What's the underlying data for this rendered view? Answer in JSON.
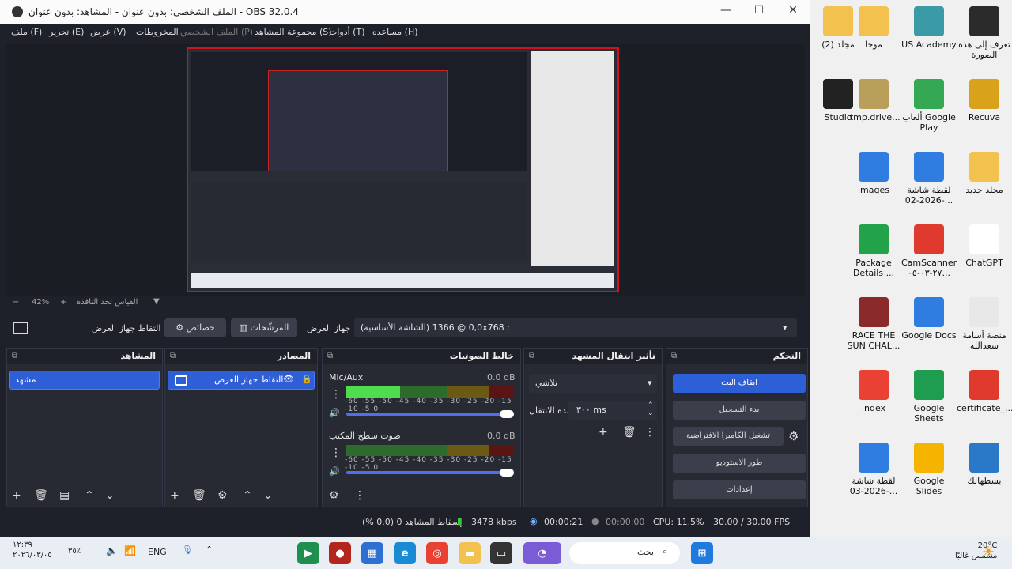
{
  "window": {
    "title": "الملف الشخصي: بدون عنوان - المشاهد: بدون عنوان - OBS 32.0.4",
    "minimize": "—",
    "maximize": "☐",
    "close": "✕"
  },
  "menu": [
    "ملف (F)",
    "تحرير (E)",
    "عرض (V)",
    "المخروطات",
    "الملف الشخصي (P)",
    "مجموعة المشاهد (S)",
    "أدوات (T)",
    "مساعده (H)"
  ],
  "preview": {
    "zoom": "42%",
    "zoom_hint": "القياس لحد النافذة",
    "minus": "−",
    "plus": "+"
  },
  "source_bar": {
    "source_name": "التقاط جهاز العرض",
    "properties": "خصائص",
    "filters": "المرشّحات",
    "display_label": "جهاز العرض",
    "display_value": "(الشاشة الأساسية) 0,0 @ 1366x768 :"
  },
  "scenes": {
    "title": "المشاهد",
    "items": [
      "مشهد"
    ]
  },
  "sources": {
    "title": "المصادر",
    "items": [
      "التقاط جهاز العرض"
    ]
  },
  "mixer": {
    "title": "خالط الصوتيات",
    "channels": [
      {
        "name": "Mic/Aux",
        "db": "0.0 dB",
        "level": 0.32
      },
      {
        "name": "صوت سطح المكتب",
        "db": "0.0 dB",
        "level": 0.0
      }
    ],
    "scale": "-60 -55 -50 -45 -40 -35 -30 -25 -20 -15 -10 -5 0"
  },
  "transitions": {
    "title": "تأثير انتقال المشهد",
    "selected": "تلاشي",
    "duration_label": "مدة الانتقال",
    "duration": "٣٠٠ ms"
  },
  "controls": {
    "title": "التحكم",
    "buttons": [
      "ايقاف البث",
      "بدء التسجيل",
      "تشغيل الكاميرا الافتراضية",
      "طور الاستوديو",
      "إعدادات"
    ]
  },
  "status": {
    "dropped": "إسقاط المشاهد 0 (0.0 %)",
    "kbps": "3478 kbps",
    "stream_time": "00:00:21",
    "rec_time": "00:00:00",
    "cpu": "CPU: 11.5%",
    "fps": "30.00 / 30.00 FPS"
  },
  "desktop_icons": [
    {
      "label": "تعرف إلى هذه الصورة",
      "icon": "info-icon",
      "color": "#2b2b2b"
    },
    {
      "label": "US Academy",
      "icon": "us-academy-icon",
      "color": "#3a9aa6"
    },
    {
      "label": "موجا",
      "icon": "folder-icon",
      "color": "#f2c14e"
    },
    {
      "label": "مجلد (2)",
      "icon": "folder-icon",
      "color": "#f2c14e"
    },
    {
      "label": "Recuva",
      "icon": "recuva-icon",
      "color": "#d9a21b"
    },
    {
      "label": "ألعاب Google Play",
      "icon": "play-games-icon",
      "color": "#34a853"
    },
    {
      "label": ".tmp.drive...",
      "icon": "folder-icon",
      "color": "#b9a05a"
    },
    {
      "label": "Studio",
      "icon": "obs-icon",
      "color": "#222"
    },
    {
      "label": "مجلد جديد",
      "icon": "folder-icon",
      "color": "#f2c14e"
    },
    {
      "label": "لقطة شاشة 2026-02-...",
      "icon": "image-icon",
      "color": "#2f7de1"
    },
    {
      "label": "images",
      "icon": "image-icon",
      "color": "#2f7de1"
    },
    {
      "label": "ChatGPT",
      "icon": "chatgpt-icon",
      "color": "#fff"
    },
    {
      "label": "CamScanner ٢٧-٠٣-٠٥...",
      "icon": "pdf-icon",
      "color": "#e03a2f"
    },
    {
      "label": "Package Details ...",
      "icon": "package-icon",
      "color": "#22a34a"
    },
    {
      "label": "منصة أسامة سعدالله",
      "icon": "file-icon",
      "color": "#e8e8e8"
    },
    {
      "label": "Google Docs",
      "icon": "docs-icon",
      "color": "#2f7de1"
    },
    {
      "label": "RACE THE SUN CHAL...",
      "icon": "game-icon",
      "color": "#8a2a2a"
    },
    {
      "label": "certificate_...",
      "icon": "pdf-icon",
      "color": "#e03a2f"
    },
    {
      "label": "Google Sheets",
      "icon": "sheets-icon",
      "color": "#1e9d51"
    },
    {
      "label": "index",
      "icon": "chrome-icon",
      "color": "#e94235"
    },
    {
      "label": "بسطهالك",
      "icon": "brand-icon",
      "color": "#2a79c9"
    },
    {
      "label": "Google Slides",
      "icon": "slides-icon",
      "color": "#f4b400"
    },
    {
      "label": "لقطة شاشة 2026-03-...",
      "icon": "image-icon",
      "color": "#2f7de1"
    }
  ],
  "taskbar": {
    "weather_temp": "20°C",
    "weather_text": "مشمس غالبًا",
    "search": "بحث",
    "lang": "ENG",
    "battery": "٣٥٪",
    "time": "١٢:٣٩",
    "date": "٢٠٢٦/٠٣/٠٥"
  }
}
